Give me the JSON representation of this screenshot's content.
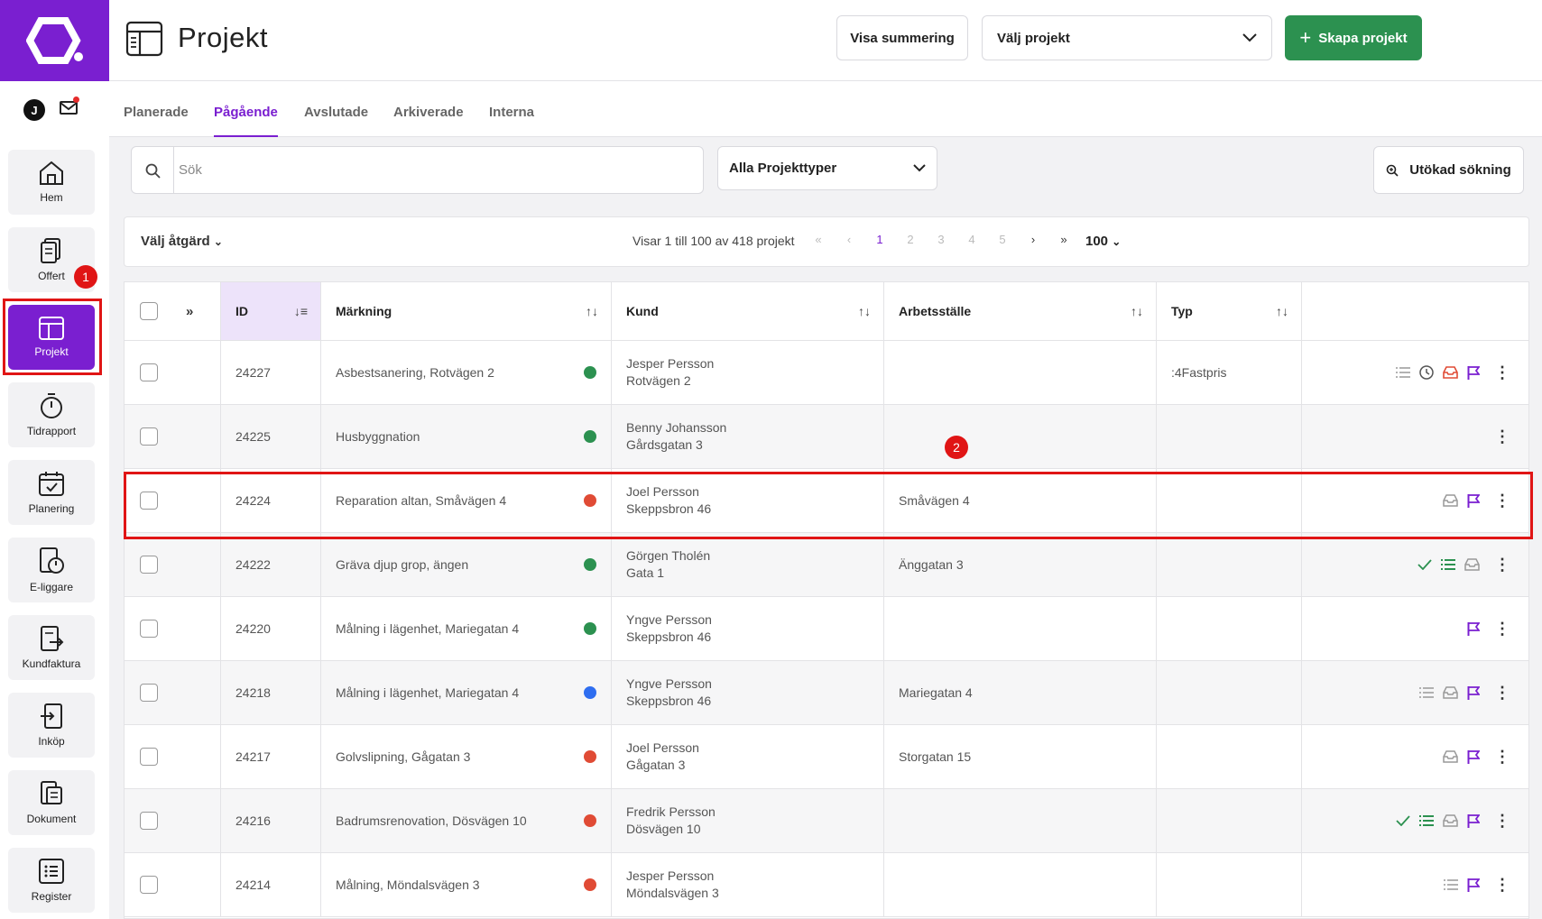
{
  "header": {
    "page_title": "Projekt",
    "summary_button": "Visa summering",
    "project_select": "Välj projekt",
    "create_button": "Skapa projekt"
  },
  "user": {
    "avatar_initial": "J"
  },
  "tabs": [
    {
      "label": "Planerade"
    },
    {
      "label": "Pågående",
      "active": true
    },
    {
      "label": "Avslutade"
    },
    {
      "label": "Arkiverade"
    },
    {
      "label": "Interna"
    }
  ],
  "sidebar": {
    "items": [
      {
        "label": "Hem",
        "icon": "home-icon"
      },
      {
        "label": "Offert",
        "icon": "quote-icon"
      },
      {
        "label": "Projekt",
        "icon": "project-icon",
        "active": true
      },
      {
        "label": "Tidrapport",
        "icon": "stopwatch-icon"
      },
      {
        "label": "Planering",
        "icon": "calendar-check-icon"
      },
      {
        "label": "E-liggare",
        "icon": "log-icon"
      },
      {
        "label": "Kundfaktura",
        "icon": "invoice-icon"
      },
      {
        "label": "Inköp",
        "icon": "purchase-icon"
      },
      {
        "label": "Dokument",
        "icon": "document-icon"
      },
      {
        "label": "Register",
        "icon": "list-icon"
      }
    ]
  },
  "annotations": {
    "badge_1": "1",
    "badge_2": "2"
  },
  "filters": {
    "search_placeholder": "Sök",
    "project_type": "Alla Projekttyper",
    "advanced_search": "Utökad sökning"
  },
  "action_bar": {
    "action_select": "Välj åtgärd",
    "paging_info": "Visar 1 till 100 av 418 projekt",
    "pages": [
      "1",
      "2",
      "3",
      "4",
      "5"
    ],
    "current_page": "1",
    "per_page": "100"
  },
  "table": {
    "columns": {
      "id": "ID",
      "marking": "Märkning",
      "customer": "Kund",
      "workplace": "Arbetsställe",
      "type": "Typ"
    },
    "rows": [
      {
        "id": "24227",
        "marking": "Asbestsanering, Rotvägen 2",
        "status": "#2c9150",
        "customer_name": "Jesper Persson",
        "customer_addr": "Rotvägen 2",
        "workplace": "",
        "type": ":4Fastpris",
        "icons": [
          "list",
          "clock",
          "inbox-red",
          "flag"
        ]
      },
      {
        "id": "24225",
        "marking": "Husbyggnation",
        "status": "#2c9150",
        "customer_name": "Benny Johansson",
        "customer_addr": "Gårdsgatan 3",
        "workplace": "",
        "type": "",
        "icons": []
      },
      {
        "id": "24224",
        "marking": "Reparation altan, Småvägen 4",
        "status": "#e04b35",
        "customer_name": "Joel Persson",
        "customer_addr": "Skeppsbron 46",
        "workplace": "Småvägen 4",
        "type": "",
        "icons": [
          "inbox",
          "flag"
        ]
      },
      {
        "id": "24222",
        "marking": "Gräva djup grop, ängen",
        "status": "#2c9150",
        "customer_name": "Görgen Tholén",
        "customer_addr": "Gata 1",
        "workplace": "Änggatan 3",
        "type": "",
        "icons": [
          "check",
          "list-green",
          "inbox"
        ]
      },
      {
        "id": "24220",
        "marking": "Målning i lägenhet, Mariegatan 4",
        "status": "#2c9150",
        "customer_name": "Yngve Persson",
        "customer_addr": "Skeppsbron 46",
        "workplace": "",
        "type": "",
        "icons": [
          "flag"
        ]
      },
      {
        "id": "24218",
        "marking": "Målning i lägenhet, Mariegatan 4",
        "status": "#2f6ef0",
        "customer_name": "Yngve Persson",
        "customer_addr": "Skeppsbron 46",
        "workplace": "Mariegatan 4",
        "type": "",
        "icons": [
          "list",
          "inbox",
          "flag"
        ]
      },
      {
        "id": "24217",
        "marking": "Golvslipning, Gågatan 3",
        "status": "#e04b35",
        "customer_name": "Joel Persson",
        "customer_addr": "Gågatan 3",
        "workplace": "Storgatan 15",
        "type": "",
        "icons": [
          "inbox",
          "flag"
        ]
      },
      {
        "id": "24216",
        "marking": "Badrumsrenovation, Dösvägen 10",
        "status": "#e04b35",
        "customer_name": "Fredrik Persson",
        "customer_addr": "Dösvägen 10",
        "workplace": "",
        "type": "",
        "icons": [
          "check",
          "list-green",
          "inbox",
          "flag"
        ]
      },
      {
        "id": "24214",
        "marking": "Målning, Möndalsvägen 3",
        "status": "#e04b35",
        "customer_name": "Jesper Persson",
        "customer_addr": "Möndalsvägen 3",
        "workplace": "",
        "type": "",
        "icons": [
          "list",
          "flag"
        ]
      }
    ]
  },
  "colors": {
    "brand": "#7a1fd0",
    "create": "#2c9150",
    "highlight": "#e01515"
  }
}
